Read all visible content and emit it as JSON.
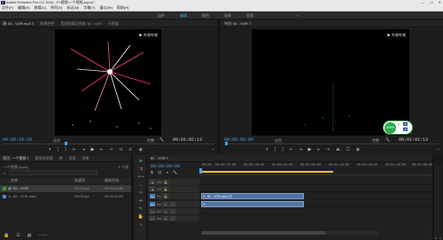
{
  "window": {
    "title": "Adobe Premiere Pro CC 2015 - F:\\视频\\一个视频.prproj *",
    "app_icon": "Pr",
    "buttons": [
      "—",
      "☐",
      "✕"
    ]
  },
  "menu": [
    "文件(F)",
    "编辑(E)",
    "剪辑(C)",
    "序列(S)",
    "标记(M)",
    "字幕(T)",
    "窗口(W)",
    "帮助(H)"
  ],
  "workspaces": {
    "tabs": [
      {
        "label": "组件",
        "active": false
      },
      {
        "label": "编辑",
        "active": true
      },
      {
        "label": "颜色",
        "active": false
      },
      {
        "label": "效果",
        "active": false
      },
      {
        "label": "音频",
        "active": false
      }
    ],
    "more": "»"
  },
  "source": {
    "tabs": [
      {
        "label": "源: 82 - VOR.mp4 ≡",
        "on": true
      },
      {
        "label": "效果控件",
        "on": false
      },
      {
        "label": "音频剪辑混合器: 82 - VOR",
        "on": false
      },
      {
        "label": "元数据",
        "on": false
      }
    ],
    "timecode_left": "00:00:19:10",
    "fit": "适合",
    "quality": "完整",
    "timecode_right": "00:01:02:13",
    "watermark": "▶ 哔哩哔哩",
    "menu_icon": "≡"
  },
  "program": {
    "tabs": [
      {
        "label": "节目: 82 - VOR ≡",
        "on": true
      }
    ],
    "timecode_left": "00:00:00:00",
    "fit": "适合",
    "quality": "完整",
    "timecode_right": "00:01:02:13",
    "watermark": "▶ 哔哩哔哩",
    "hud": {
      "percent": "100%",
      "left": "T",
      "right": [
        "00",
        "45"
      ],
      "bottom": "0"
    }
  },
  "project": {
    "tabs": [
      {
        "label": "项目: 一个视频 ≡",
        "on": true
      },
      {
        "label": "媒体浏览器",
        "on": false
      },
      {
        "label": "库",
        "on": false
      },
      {
        "label": "信息",
        "on": false
      },
      {
        "label": "效果",
        "on": false
      }
    ],
    "file": "一个视频.prproj",
    "count": "1 个项",
    "search_icon": "⌕",
    "columns": [
      "名称",
      "帧速率",
      "媒体开始"
    ],
    "rows": [
      {
        "name": "82 - VOR",
        "fps": "25.00 fps",
        "start": "00:00:00:00",
        "color": "#3c9a3c",
        "icon": "sequence-icon"
      },
      {
        "name": "82 - VOR.mp4",
        "fps": "25.00 fps",
        "start": "00:00:00:00",
        "color": "#4a8ad0",
        "icon": "video-clip-icon"
      }
    ]
  },
  "timeline": {
    "tab": "82 - VOR ≡",
    "timecode": "00:00:00:00",
    "ruler": [
      "00:00",
      "00:00:15:00",
      "00:00:30:00",
      "00:00:45:00",
      "00:01:00:00",
      "00:01:15:00",
      "00:01:30:00",
      "00:01:45:00",
      "00:02:00:00"
    ],
    "video_tracks": [
      "V3",
      "V2",
      "V1"
    ],
    "audio_tracks": [
      "A1",
      "A2",
      "A3"
    ],
    "track_btn_video": [
      "⬚",
      "M",
      "S"
    ],
    "track_btn_audio": [
      "M",
      "S",
      "🎙"
    ],
    "video_clip": "82 - VOR.mp4 [V]",
    "fx": "fx"
  },
  "meters": {
    "labels": [
      "S",
      "S"
    ]
  },
  "colors": {
    "accent_blue": "#4aa3e6",
    "playhead_yellow": "#e8c23a"
  }
}
